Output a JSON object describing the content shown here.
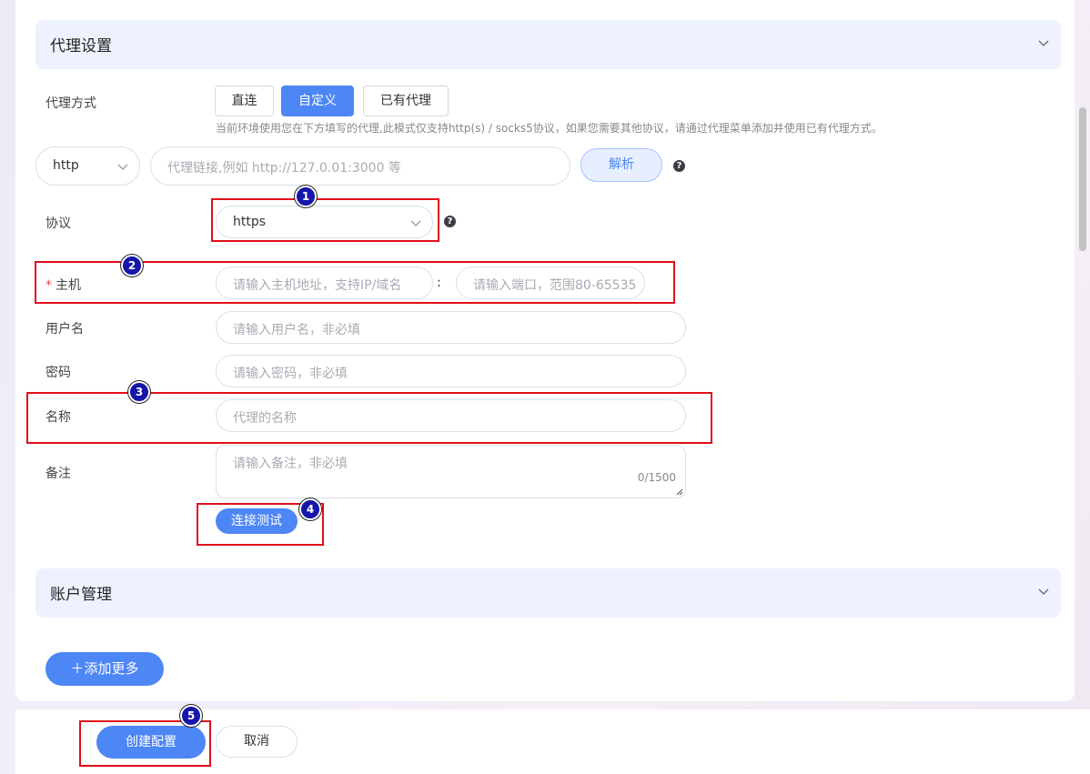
{
  "proxy_section": {
    "title": "代理设置"
  },
  "proxy_method": {
    "label": "代理方式",
    "options": [
      "直连",
      "自定义",
      "已有代理"
    ],
    "selected": "自定义",
    "hint": "当前环境使用您在下方填写的代理,此模式仅支持http(s) / socks5协议，如果您需要其他协议，请通过代理菜单添加并使用已有代理方式。"
  },
  "quick_parse": {
    "scheme": "http",
    "placeholder": "代理链接,例如 http://127.0.01:3000 等",
    "parse_label": "解析"
  },
  "protocol": {
    "label": "协议",
    "value": "https"
  },
  "host": {
    "label": "主机",
    "host_placeholder": "请输入主机地址，支持IP/域名",
    "separator": ":",
    "port_placeholder": "请输入端口，范围80-65535"
  },
  "username": {
    "label": "用户名",
    "placeholder": "请输入用户名，非必填"
  },
  "password": {
    "label": "密码",
    "placeholder": "请输入密码，非必填"
  },
  "name": {
    "label": "名称",
    "placeholder": "代理的名称"
  },
  "remark": {
    "label": "备注",
    "placeholder": "请输入备注，非必填",
    "counter": "0/1500"
  },
  "test_button": "连接测试",
  "account_section": {
    "title": "账户管理"
  },
  "add_more": "＋添加更多",
  "footer": {
    "create": "创建配置",
    "cancel": "取消"
  },
  "help_glyph": "?",
  "annotations": [
    "1",
    "2",
    "3",
    "4",
    "5"
  ],
  "colors": {
    "primary": "#4d86f5",
    "highlight": "#e0101a",
    "badge": "#1616a8"
  }
}
